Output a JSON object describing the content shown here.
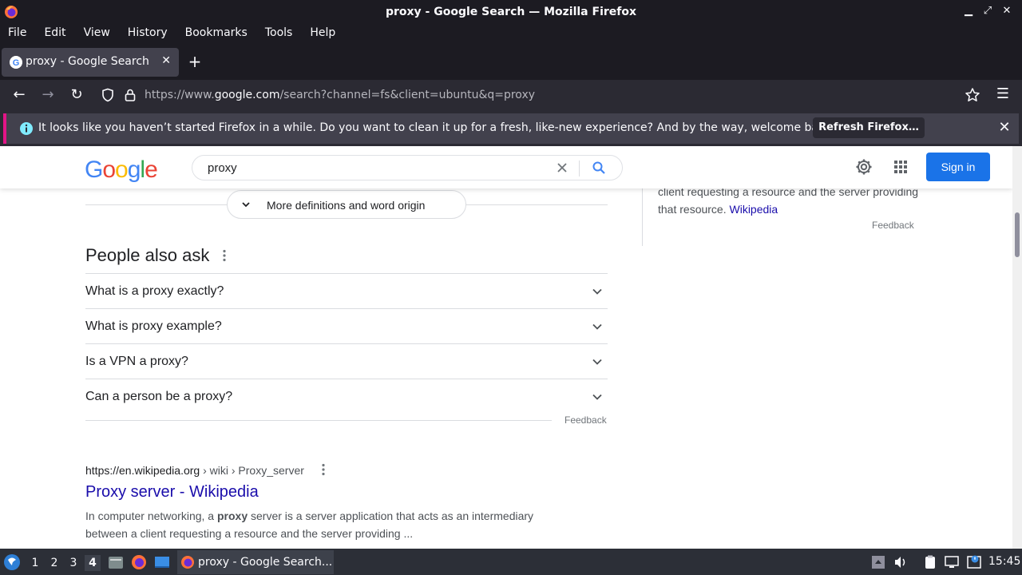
{
  "window": {
    "title": "proxy - Google Search — Mozilla Firefox"
  },
  "menubar": {
    "items": [
      "File",
      "Edit",
      "View",
      "History",
      "Bookmarks",
      "Tools",
      "Help"
    ]
  },
  "tabs": [
    {
      "label": "proxy - Google Search",
      "active": true
    }
  ],
  "urlbar": {
    "prefix": "https://www.",
    "host": "google.com",
    "path": "/search?channel=fs&client=ubuntu&q=proxy"
  },
  "notification": {
    "message": "It looks like you haven’t started Firefox in a while. Do you want to clean it up for a fresh, like-new experience? And by the way, welcome back!",
    "button": "Refresh Firefox…"
  },
  "google": {
    "logo_letters": [
      "G",
      "o",
      "o",
      "g",
      "l",
      "e"
    ],
    "logo_colors": [
      "#4285f4",
      "#ea4335",
      "#fbbc05",
      "#4285f4",
      "#34a853",
      "#ea4335"
    ],
    "query": "proxy",
    "signin_label": "Sign in",
    "more_definitions": "More definitions and word origin",
    "people_also_ask": {
      "title": "People also ask",
      "questions": [
        "What is a proxy exactly?",
        "What is proxy example?",
        "Is a VPN a proxy?",
        "Can a person be a proxy?"
      ],
      "feedback": "Feedback"
    },
    "result": {
      "cite_host": "https://en.wikipedia.org",
      "cite_path": " › wiki › Proxy_server",
      "title": "Proxy server - Wikipedia",
      "snippet_pre": "In computer networking, a ",
      "snippet_bold": "proxy",
      "snippet_post": " server is a server application that acts as an intermediary between a client requesting a resource and the server providing ..."
    },
    "knowledge_panel": {
      "text": "client requesting a resource and the server providing that resource. ",
      "link": "Wikipedia",
      "feedback": "Feedback"
    }
  },
  "taskbar": {
    "workspaces": [
      "1",
      "2",
      "3",
      "4"
    ],
    "active_workspace": "4",
    "task_label": "proxy - Google Search...",
    "clock": "15:45"
  },
  "colors": {
    "accent": "#1a73e8",
    "link": "#1a0dab",
    "notification_stripe": "#e31587"
  }
}
